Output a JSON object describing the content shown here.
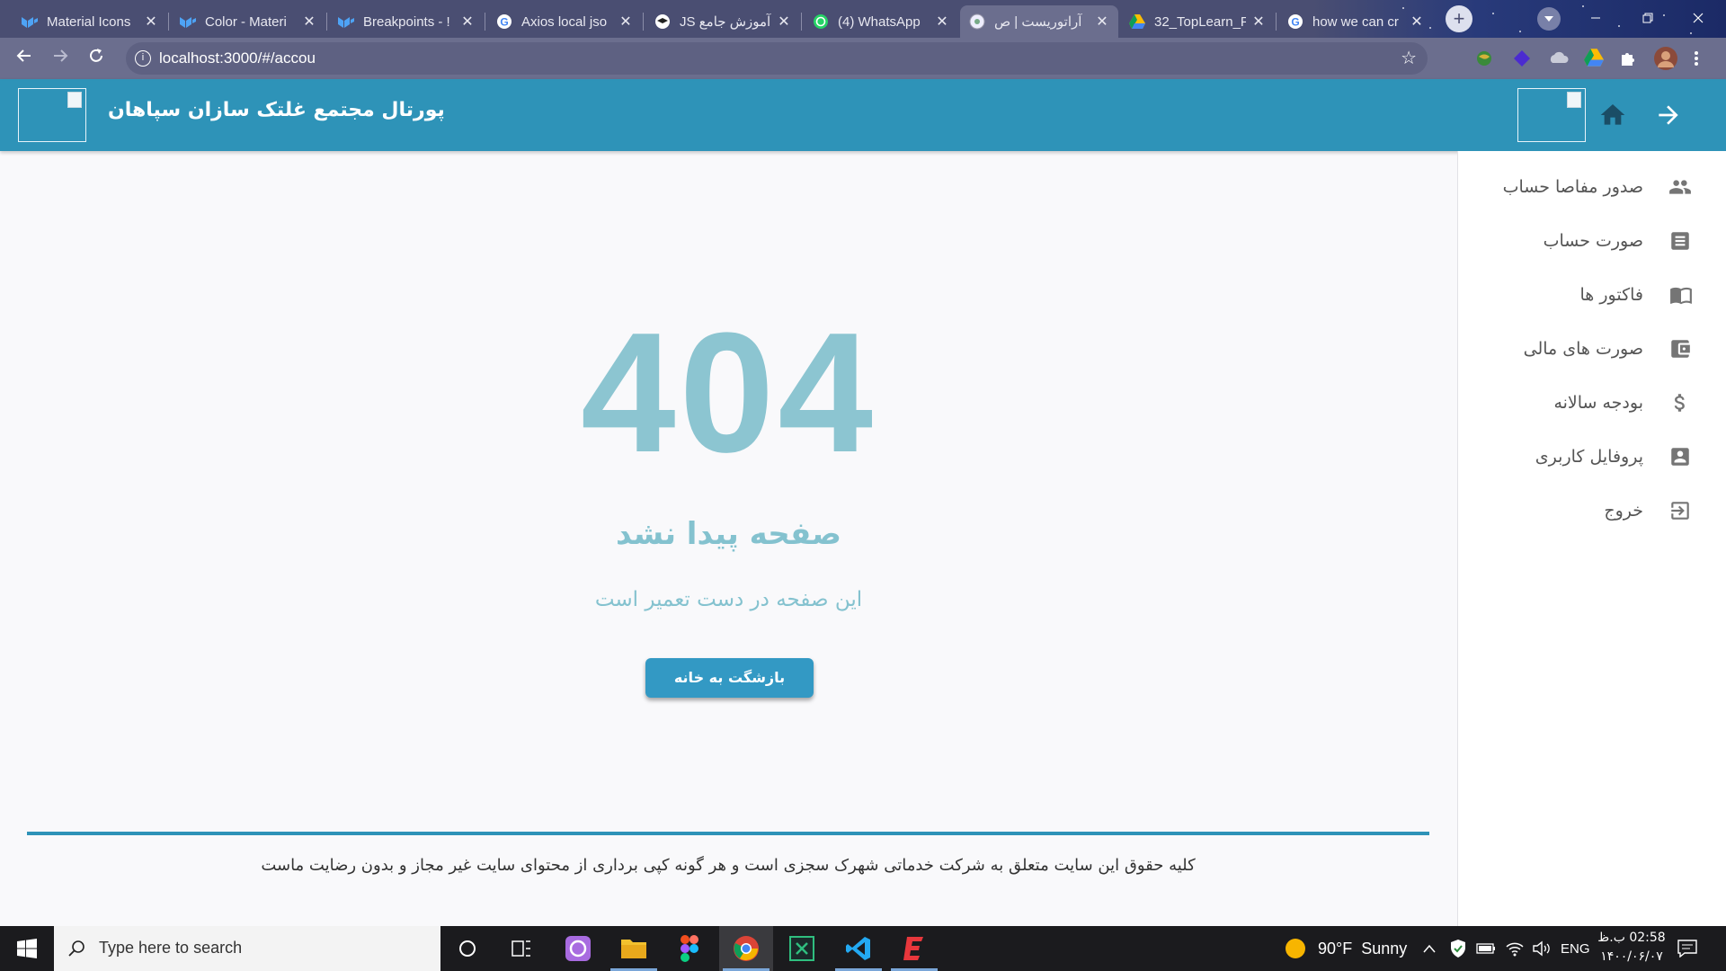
{
  "browser": {
    "tabs": [
      {
        "title": "Material Icons",
        "icon": "mui-logo-icon"
      },
      {
        "title": "Color - Materi",
        "icon": "mui-logo-icon"
      },
      {
        "title": "Breakpoints - !",
        "icon": "mui-logo-icon"
      },
      {
        "title": "Axios local jso",
        "icon": "google-icon"
      },
      {
        "title": "آموزش جامع JS",
        "icon": "toplearn-icon"
      },
      {
        "title": "(4) WhatsApp",
        "icon": "whatsapp-icon"
      },
      {
        "title": "آراتوریست | ص",
        "icon": "site-icon",
        "active": true
      },
      {
        "title": "32_TopLearn_F",
        "icon": "google-drive-icon"
      },
      {
        "title": "how we can cr",
        "icon": "google-icon"
      }
    ],
    "url": "localhost:3000/#/accou",
    "close_glyph": "✕"
  },
  "app": {
    "title": "پورتال مجتمع غلتک سازان سپاهان",
    "accent": "#2e93b8"
  },
  "sidebar": {
    "items": [
      {
        "label": "صدور مفاصا حساب",
        "icon": "people-icon"
      },
      {
        "label": "صورت حساب",
        "icon": "receipt-icon"
      },
      {
        "label": "فاکتور ها",
        "icon": "book-icon"
      },
      {
        "label": "صورت های مالی",
        "icon": "wallet-icon"
      },
      {
        "label": "بودجه سالانه",
        "icon": "dollar-icon"
      },
      {
        "label": "پروفایل کاربری",
        "icon": "account-box-icon"
      },
      {
        "label": "خروج",
        "icon": "logout-icon"
      }
    ]
  },
  "error": {
    "code": "404",
    "title": "صفحه پیدا نشد",
    "subtitle": "این صفحه در دست تعمیر است",
    "button": "بازشگت به خانه"
  },
  "footer": {
    "text": "کلیه حقوق این سایت متعلق به شرکت خدماتی شهرک سجزی است و هر گونه کپی برداری از محتوای سایت غیر مجاز و بدون رضایت ماست"
  },
  "taskbar": {
    "search_placeholder": "Type here to search",
    "weather": "90°F  Sunny",
    "lang": "ENG",
    "time": "02:58 ب.ظ",
    "date": "۱۴۰۰/۰۶/۰۷"
  }
}
